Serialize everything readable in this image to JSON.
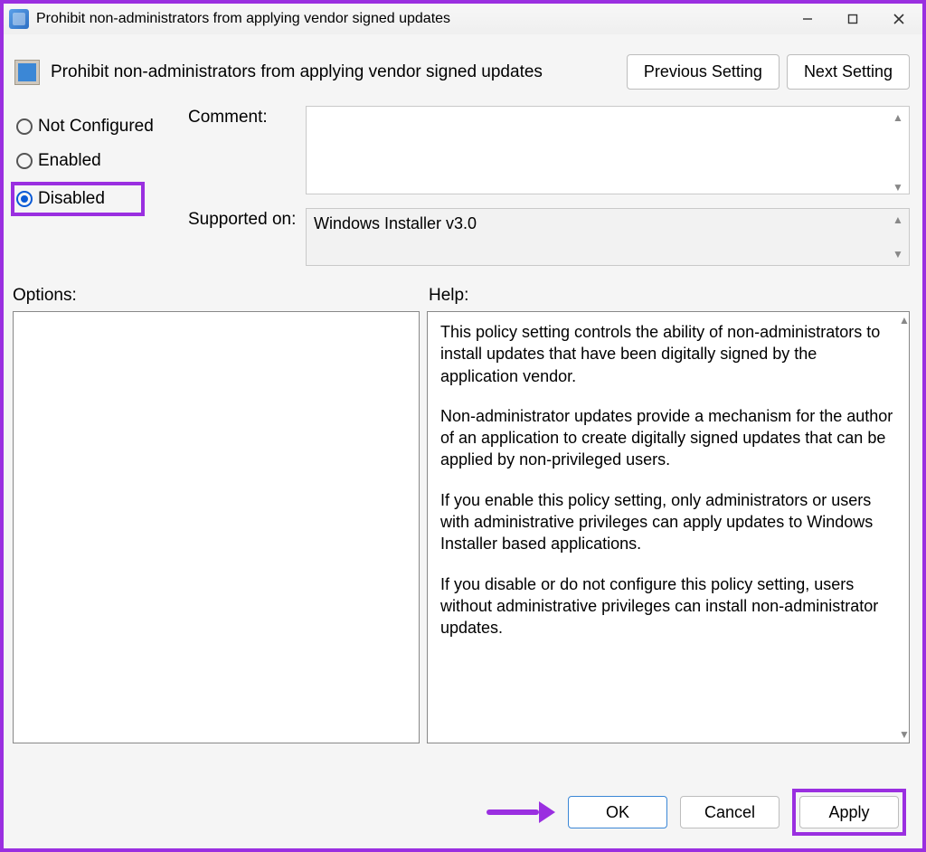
{
  "window": {
    "title": "Prohibit non-administrators from applying vendor signed updates"
  },
  "header": {
    "title": "Prohibit non-administrators from applying vendor signed updates",
    "prev_label": "Previous Setting",
    "next_label": "Next Setting"
  },
  "radio": {
    "not_configured": "Not Configured",
    "enabled": "Enabled",
    "disabled": "Disabled",
    "selected": "disabled"
  },
  "fields": {
    "comment_label": "Comment:",
    "comment_value": "",
    "supported_label": "Supported on:",
    "supported_value": "Windows Installer v3.0"
  },
  "sections": {
    "options_label": "Options:",
    "help_label": "Help:"
  },
  "help": {
    "p1": "This policy setting controls the ability of non-administrators to install updates that have been digitally signed by the application vendor.",
    "p2": "Non-administrator updates provide a mechanism for the author of an application to create digitally signed updates that can be applied by non-privileged users.",
    "p3": "If you enable this policy setting, only administrators or users with administrative privileges can apply updates to Windows Installer based applications.",
    "p4": "If you disable or do not configure this policy setting, users without administrative privileges can install non-administrator updates."
  },
  "footer": {
    "ok": "OK",
    "cancel": "Cancel",
    "apply": "Apply"
  }
}
